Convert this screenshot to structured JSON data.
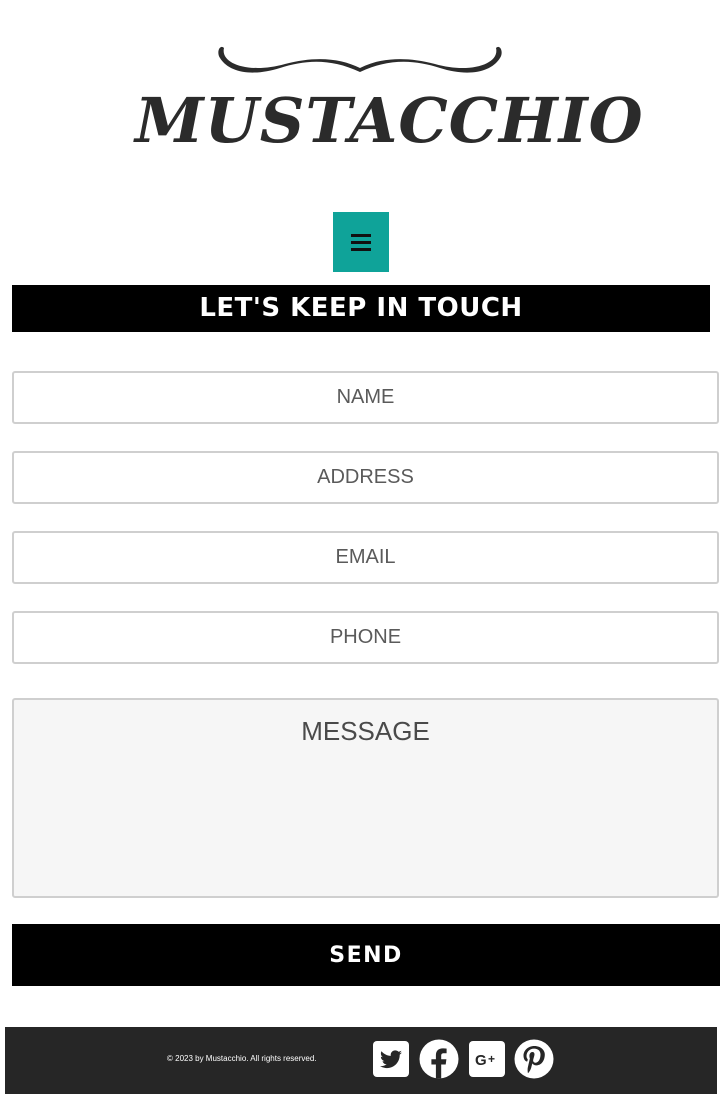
{
  "logo": {
    "text": "MUSTACCHIO"
  },
  "nav": {
    "menu_icon": "hamburger-menu-icon",
    "menu_color": "#0fa399"
  },
  "heading": {
    "title": "LET'S KEEP IN TOUCH"
  },
  "form": {
    "name_placeholder": "NAME",
    "address_placeholder": "ADDRESS",
    "email_placeholder": "EMAIL",
    "phone_placeholder": "PHONE",
    "message_placeholder": "MESSAGE",
    "send_label": "SEND"
  },
  "footer": {
    "copyright": "© 2023 by Mustacchio. All rights reserved.",
    "social": [
      "twitter-icon",
      "facebook-icon",
      "google-plus-icon",
      "pinterest-icon"
    ]
  },
  "colors": {
    "accent": "#0fa399",
    "footer_bg": "#262626",
    "bar_bg": "#000000"
  }
}
